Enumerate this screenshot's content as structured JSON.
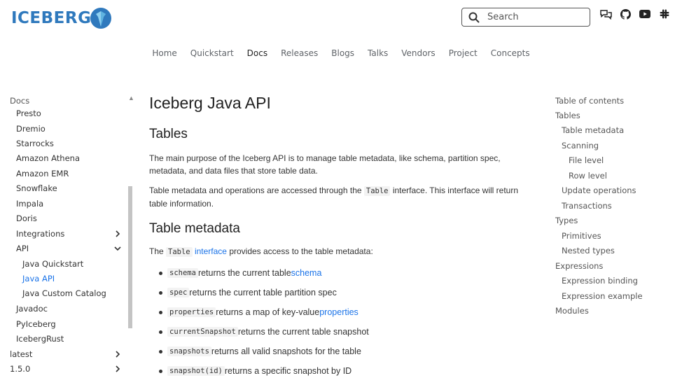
{
  "brand": {
    "logo_text": "ICEBERG"
  },
  "search": {
    "placeholder": "Search"
  },
  "header_icons": [
    "chat-icon",
    "github-icon",
    "youtube-icon",
    "slack-icon"
  ],
  "topnav": [
    "Home",
    "Quickstart",
    "Docs",
    "Releases",
    "Blogs",
    "Talks",
    "Vendors",
    "Project",
    "Concepts"
  ],
  "topnav_active": "Docs",
  "sidebar": {
    "header": "Docs",
    "items": [
      {
        "label": "Presto"
      },
      {
        "label": "Dremio"
      },
      {
        "label": "Starrocks"
      },
      {
        "label": "Amazon Athena"
      },
      {
        "label": "Amazon EMR"
      },
      {
        "label": "Snowflake"
      },
      {
        "label": "Impala"
      },
      {
        "label": "Doris"
      },
      {
        "label": "Integrations"
      },
      {
        "label": "API"
      },
      {
        "label": "Java Quickstart"
      },
      {
        "label": "Java API"
      },
      {
        "label": "Java Custom Catalog"
      },
      {
        "label": "Javadoc"
      },
      {
        "label": "PyIceberg"
      },
      {
        "label": "IcebergRust"
      },
      {
        "label": "latest"
      },
      {
        "label": "1.5.0"
      }
    ]
  },
  "content": {
    "title": "Iceberg Java API",
    "h2_tables": "Tables",
    "p1": "The main purpose of the Iceberg API is to manage table metadata, like schema, partition spec, metadata, and data files that store table data.",
    "p2_before": "Table metadata and operations are accessed through the ",
    "p2_code": "Table",
    "p2_after": " interface. This interface will return table information.",
    "h2_meta": "Table metadata",
    "p3_before": "The ",
    "p3_code": "Table",
    "p3_link": " interface",
    "p3_after": " provides access to the table metadata:",
    "bullets": [
      {
        "code": "schema",
        "text": " returns the current table ",
        "link": "schema"
      },
      {
        "code": "spec",
        "text": " returns the current table partition spec",
        "link": ""
      },
      {
        "code": "properties",
        "text": " returns a map of key-value ",
        "link": "properties"
      },
      {
        "code": "currentSnapshot",
        "text": " returns the current table snapshot",
        "link": ""
      },
      {
        "code": "snapshots",
        "text": " returns all valid snapshots for the table",
        "link": ""
      },
      {
        "code": "snapshot(id)",
        "text": " returns a specific snapshot by ID",
        "link": ""
      }
    ]
  },
  "toc": {
    "header": "Table of contents",
    "items": [
      {
        "label": "Tables"
      },
      {
        "label": "Table metadata"
      },
      {
        "label": "Scanning"
      },
      {
        "label": "File level"
      },
      {
        "label": "Row level"
      },
      {
        "label": "Update operations"
      },
      {
        "label": "Transactions"
      },
      {
        "label": "Types"
      },
      {
        "label": "Primitives"
      },
      {
        "label": "Nested types"
      },
      {
        "label": "Expressions"
      },
      {
        "label": "Expression binding"
      },
      {
        "label": "Expression example"
      },
      {
        "label": "Modules"
      }
    ]
  },
  "colors": {
    "brand": "#2f79bd",
    "link": "#1a73e8"
  }
}
